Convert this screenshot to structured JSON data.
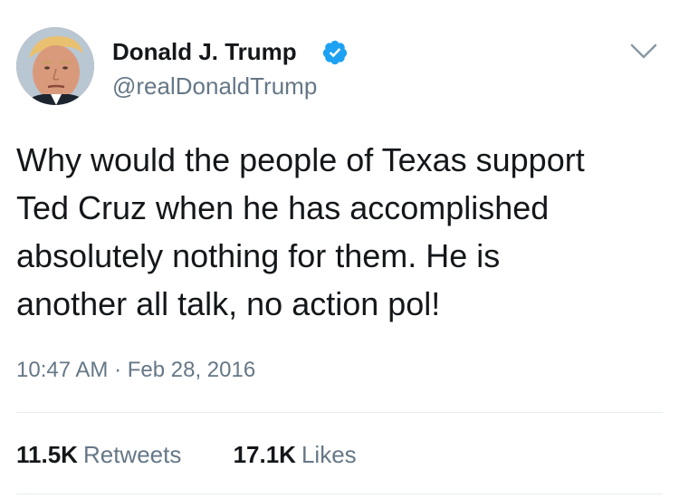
{
  "user": {
    "display_name": "Donald J. Trump",
    "handle": "@realDonaldTrump",
    "verified": true,
    "avatar_icon": "profile-photo",
    "verified_color": "#1da1f2"
  },
  "tweet": {
    "text": "Why would the people of Texas support\nTed Cruz when he has accomplished\nabsolutely nothing for them. He is\nanother all talk, no action pol!",
    "timestamp": "10:47 AM · Feb 28, 2016"
  },
  "stats": {
    "retweets_count": "11.5K",
    "retweets_label": "Retweets",
    "likes_count": "17.1K",
    "likes_label": "Likes"
  },
  "menu": {
    "icon": "chevron-down-icon"
  }
}
